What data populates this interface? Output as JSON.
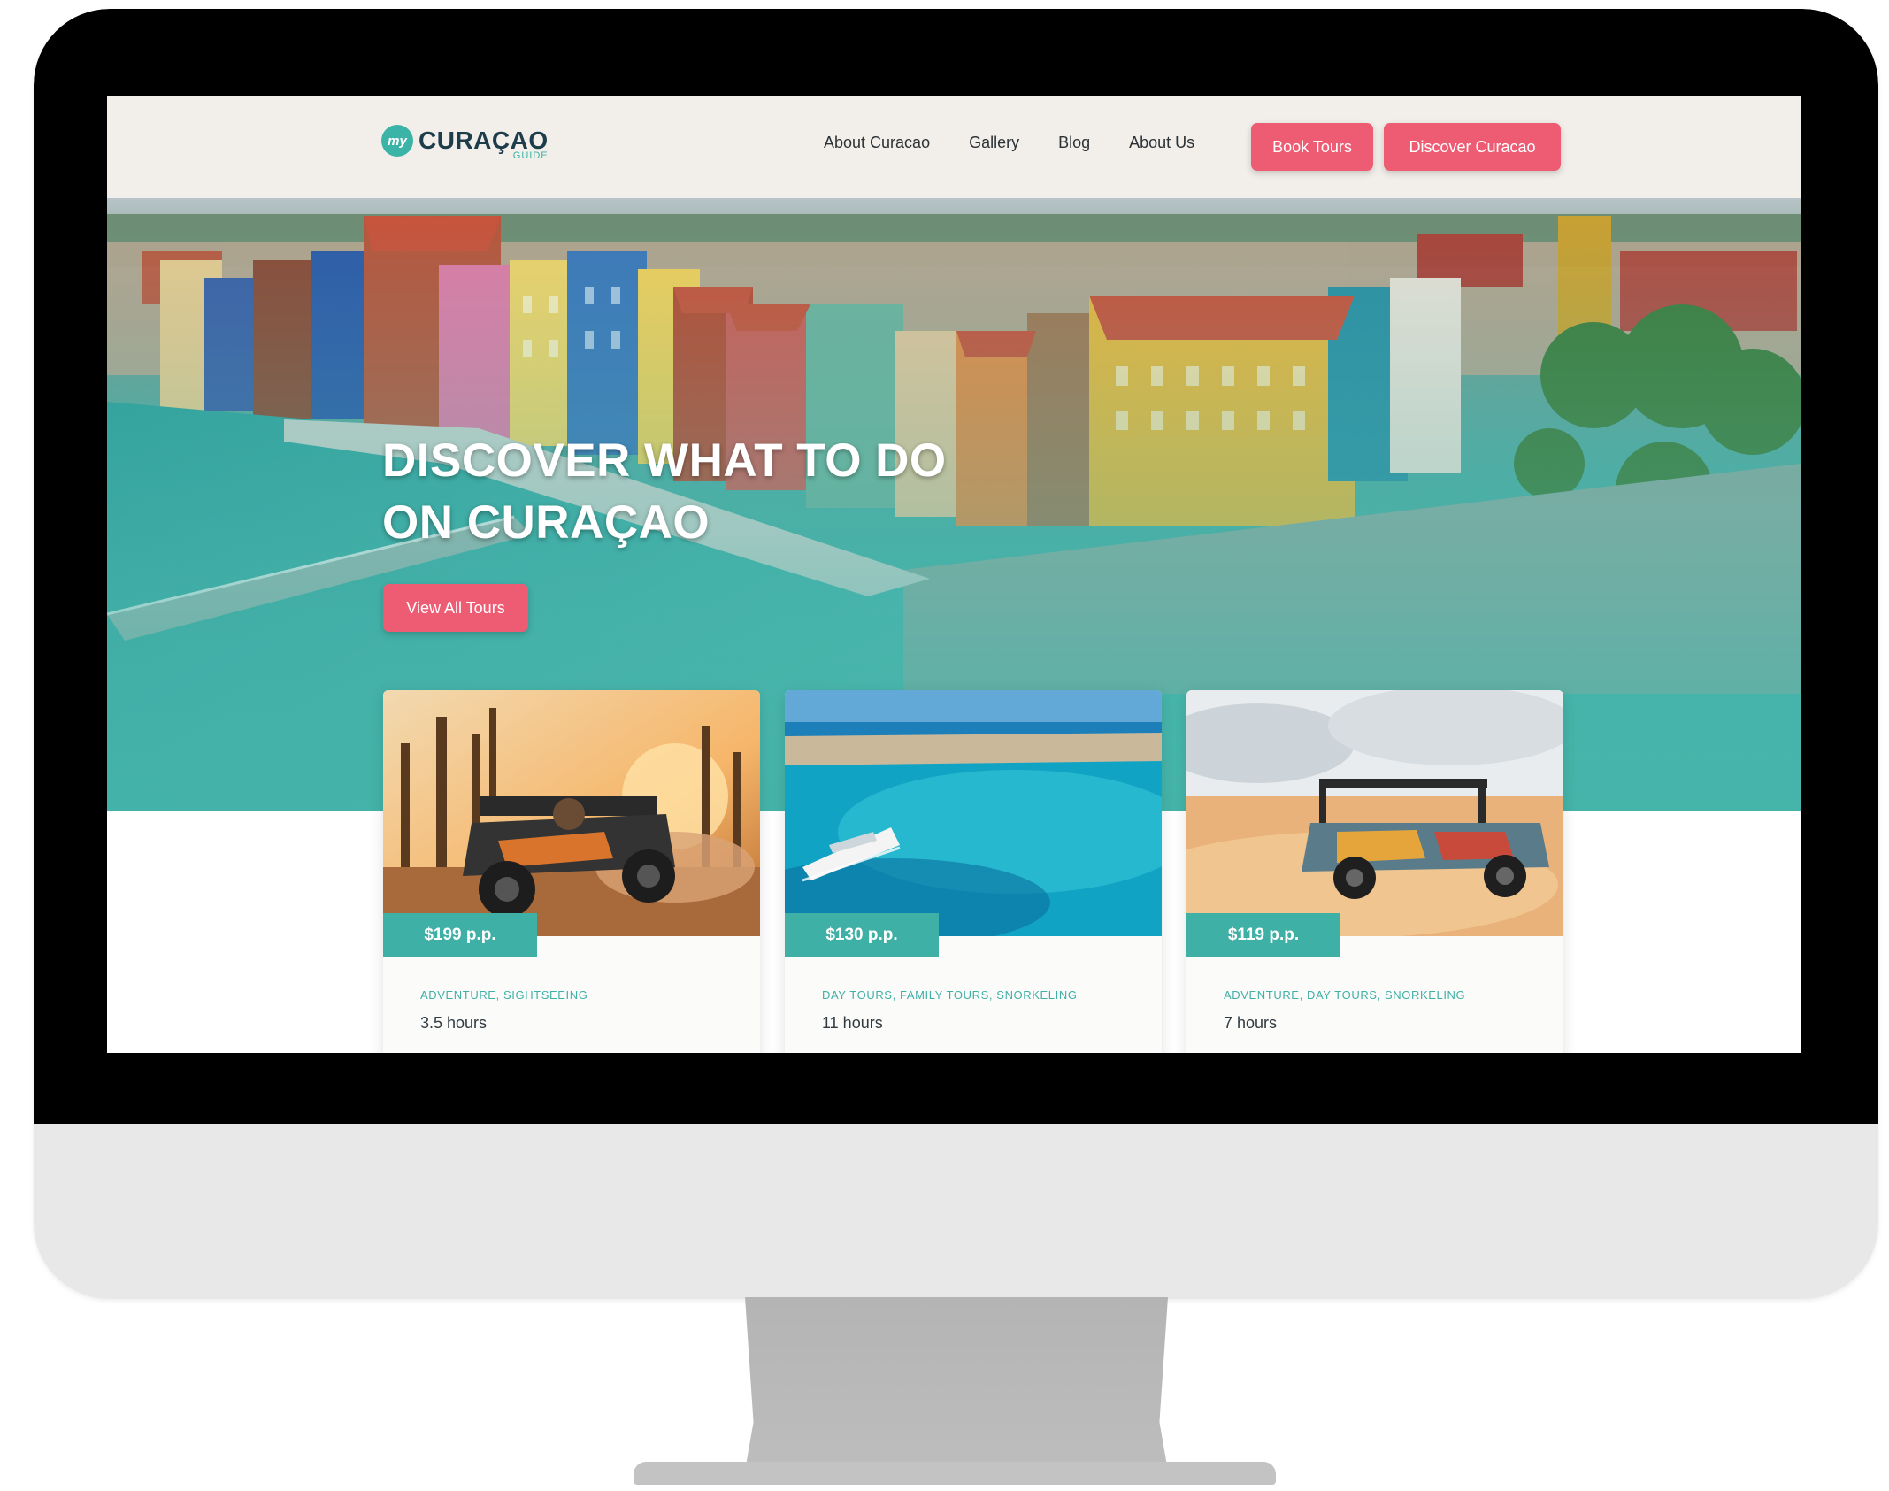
{
  "header": {
    "logo": {
      "badge": "my",
      "name": "CURAÇAO",
      "sub": "GUIDE"
    },
    "nav": [
      "About Curacao",
      "Gallery",
      "Blog",
      "About Us"
    ],
    "book_tours": "Book Tours",
    "discover": "Discover Curacao"
  },
  "hero": {
    "line1": "DISCOVER WHAT TO DO",
    "line2": "ON CURAÇAO",
    "cta": "View All Tours"
  },
  "tours": [
    {
      "price": "$199 p.p.",
      "categories": "ADVENTURE, SIGHTSEEING",
      "duration": "3.5 hours",
      "image": "atv-buggy-photo"
    },
    {
      "price": "$130 p.p.",
      "categories": "DAY TOURS, FAMILY TOURS, SNORKELING",
      "duration": "11 hours",
      "image": "yacht-lagoon-photo"
    },
    {
      "price": "$119 p.p.",
      "categories": "ADVENTURE, DAY TOURS, SNORKELING",
      "duration": "7 hours",
      "image": "safari-jeep-photo"
    }
  ],
  "colors": {
    "accent_pink": "#ee5c73",
    "teal": "#3fb0a5",
    "header_bg": "#f2eeea",
    "navy": "#1e3d4a"
  }
}
